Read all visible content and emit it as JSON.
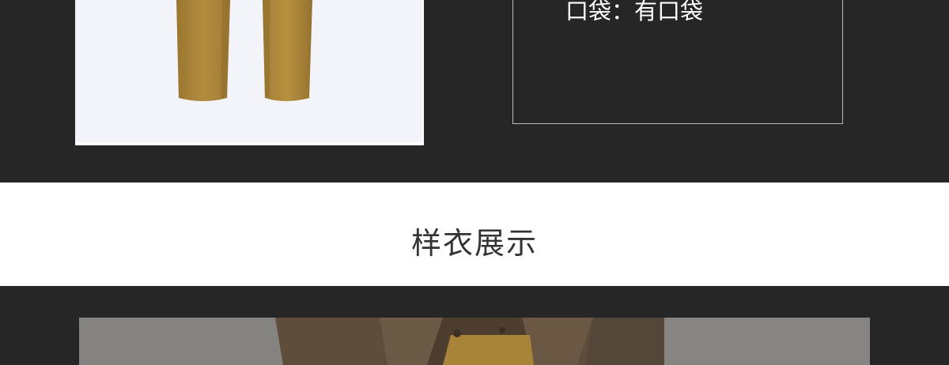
{
  "spec": {
    "pocket_line": "口袋：有口袋"
  },
  "section": {
    "title": "样衣展示"
  },
  "colors": {
    "dark_background": "#262626",
    "light_band": "#ffffff",
    "pants_khaki": "#b0893b",
    "coat_brown": "#5a4a38"
  }
}
